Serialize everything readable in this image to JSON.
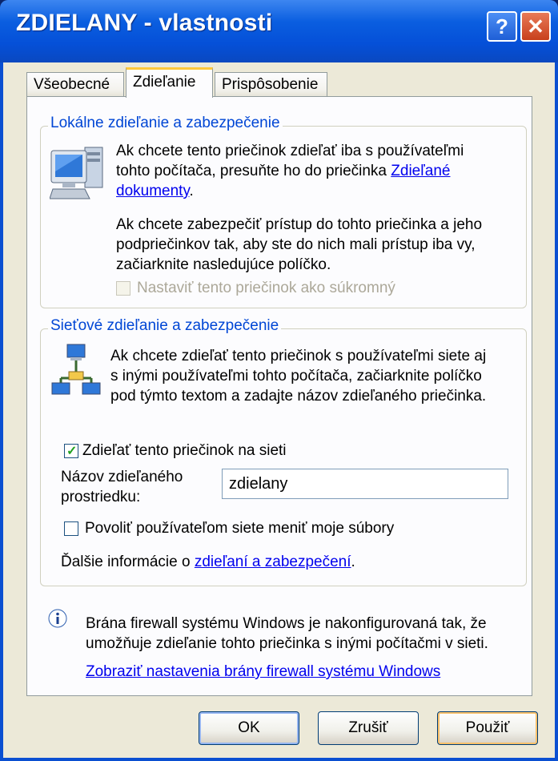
{
  "window": {
    "title": "ZDIELANY - vlastnosti",
    "help_label": "?",
    "close_label": "✕"
  },
  "tabs": [
    {
      "label": "Všeobecné"
    },
    {
      "label": "Zdieľanie"
    },
    {
      "label": "Prispôsobenie"
    }
  ],
  "local_group": {
    "legend": "Lokálne zdieľanie a zabezpečenie",
    "line1": "Ak chcete tento priečinok zdieľať iba s používateľmi",
    "line2_prefix": "tohto počítača, presuňte ho do priečinka ",
    "link_part1": "Zdieľané",
    "link_part2": "dokumenty",
    "line3_suffix": ".",
    "para2_line1": "Ak chcete zabezpečiť prístup do tohto priečinka a jeho",
    "para2_line2": "podpriečinkov tak, aby ste do nich mali prístup iba vy,",
    "para2_line3": "začiarknite nasledujúce políčko.",
    "private_checkbox_label": "Nastaviť tento priečinok ako súkromný",
    "private_checked": false
  },
  "network_group": {
    "legend": "Sieťové zdieľanie a zabezpečenie",
    "line1": "Ak chcete zdieľať tento priečinok s používateľmi siete aj",
    "line2": "s inými používateľmi tohto počítača, začiarknite políčko",
    "line3": "pod týmto textom a zadajte názov zdieľaného priečinka.",
    "share_checkbox_label": "Zdieľať tento priečinok na sieti",
    "share_checked": true,
    "share_name_label_line1": "Názov zdieľaného",
    "share_name_label_line2": "prostriedku:",
    "share_name_value": "zdielany",
    "allow_change_label": "Povoliť používateľom siete meniť moje súbory",
    "allow_change_checked": false,
    "more_info_prefix": "Ďalšie informácie o ",
    "more_info_link": "zdieľaní a zabezpečení",
    "more_info_suffix": "."
  },
  "firewall": {
    "line1": "Brána firewall systému Windows je nakonfigurovaná tak, že",
    "line2": "umožňuje zdieľanie tohto priečinka s inými počítačmi v sieti.",
    "link": "Zobraziť nastavenia brány firewall systému Windows"
  },
  "buttons": {
    "ok": "OK",
    "cancel": "Zrušiť",
    "apply": "Použiť"
  },
  "icons": {
    "local_icon": "computer-icon",
    "network_icon": "network-icon",
    "info_icon": "info-icon"
  }
}
